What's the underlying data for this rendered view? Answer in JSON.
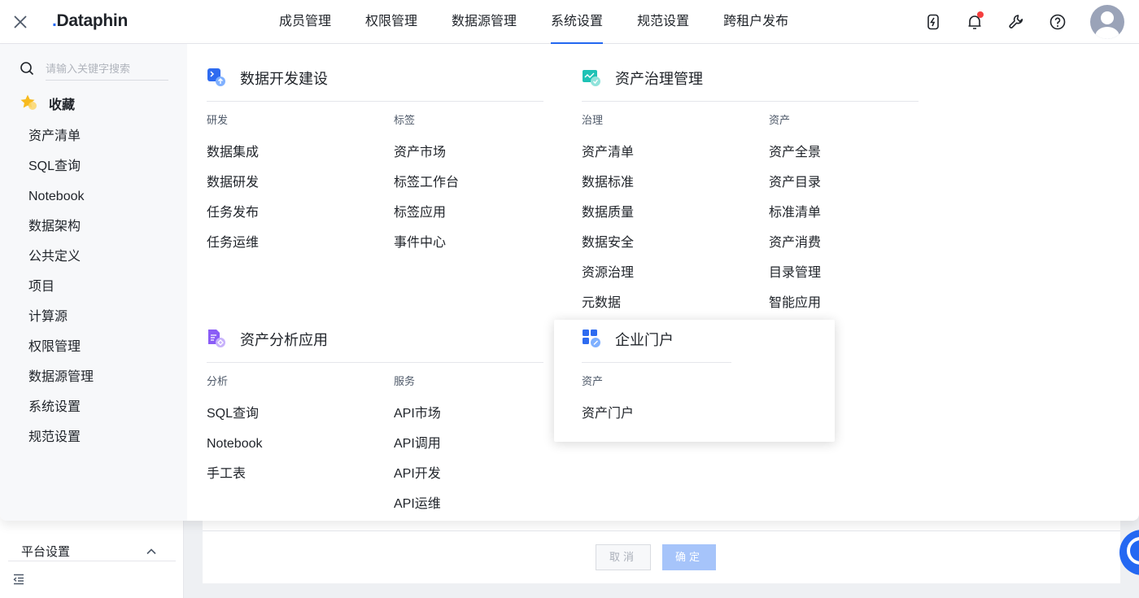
{
  "app": {
    "logo": "Dataphin",
    "accent": "#2468f2"
  },
  "nav": {
    "items": [
      {
        "label": "成员管理",
        "active": false
      },
      {
        "label": "权限管理",
        "active": false
      },
      {
        "label": "数据源管理",
        "active": false
      },
      {
        "label": "系统设置",
        "active": true
      },
      {
        "label": "规范设置",
        "active": false
      },
      {
        "label": "跨租户发布",
        "active": false
      }
    ]
  },
  "top_icons": [
    "flash-icon",
    "bell-icon",
    "wrench-icon",
    "help-icon"
  ],
  "menu": {
    "search_placeholder": "请输入关键字搜索",
    "favorites_title": "收藏",
    "favorites": [
      "资产清单",
      "SQL查询",
      "Notebook",
      "数据架构",
      "公共定义",
      "项目",
      "计算源",
      "权限管理",
      "数据源管理",
      "系统设置",
      "规范设置"
    ],
    "sections": {
      "dev": {
        "title": "数据开发建设",
        "columns": [
          {
            "title": "研发",
            "items": [
              "数据集成",
              "数据研发",
              "任务发布",
              "任务运维"
            ]
          },
          {
            "title": "标签",
            "items": [
              "资产市场",
              "标签工作台",
              "标签应用",
              "事件中心"
            ]
          }
        ]
      },
      "gov": {
        "title": "资产治理管理",
        "columns": [
          {
            "title": "治理",
            "items": [
              "资产清单",
              "数据标准",
              "数据质量",
              "数据安全",
              "资源治理",
              "元数据"
            ]
          },
          {
            "title": "资产",
            "items": [
              "资产全景",
              "资产目录",
              "标准清单",
              "资产消费",
              "目录管理",
              "智能应用"
            ]
          }
        ]
      },
      "ana": {
        "title": "资产分析应用",
        "columns": [
          {
            "title": "分析",
            "items": [
              "SQL查询",
              "Notebook",
              "手工表"
            ]
          },
          {
            "title": "服务",
            "items": [
              "API市场",
              "API调用",
              "API开发",
              "API运维"
            ]
          }
        ]
      },
      "portal": {
        "title": "企业门户",
        "columns": [
          {
            "title": "资产",
            "items": [
              "资产门户"
            ]
          }
        ]
      }
    }
  },
  "background": {
    "platform_label": "平台设置",
    "cancel_label": "取消",
    "ok_label": "确定"
  }
}
